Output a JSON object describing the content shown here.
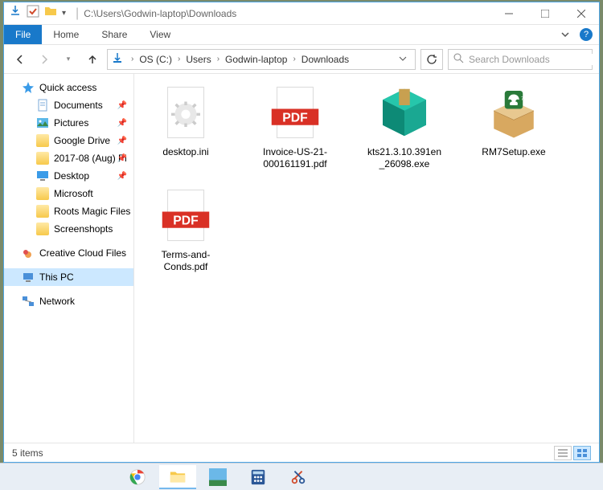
{
  "title_path": "C:\\Users\\Godwin-laptop\\Downloads",
  "ribbon": {
    "file": "File",
    "home": "Home",
    "share": "Share",
    "view": "View"
  },
  "breadcrumb": [
    "OS (C:)",
    "Users",
    "Godwin-laptop",
    "Downloads"
  ],
  "search_placeholder": "Search Downloads",
  "sidebar": {
    "quick_access": "Quick access",
    "pinned": [
      {
        "label": "Documents",
        "pinned": true
      },
      {
        "label": "Pictures",
        "pinned": true
      },
      {
        "label": "Google Drive",
        "pinned": true
      },
      {
        "label": "2017-08 (Aug) Pi",
        "pinned": true
      },
      {
        "label": "Desktop",
        "pinned": true
      },
      {
        "label": "Microsoft",
        "pinned": false
      },
      {
        "label": "Roots Magic Files",
        "pinned": false
      },
      {
        "label": "Screenshopts",
        "pinned": false
      }
    ],
    "creative_cloud": "Creative Cloud Files",
    "this_pc": "This PC",
    "network": "Network"
  },
  "files": [
    {
      "name": "desktop.ini",
      "type": "ini"
    },
    {
      "name": "Invoice-US-21-000161191.pdf",
      "type": "pdf"
    },
    {
      "name": "kts21.3.10.391en_26098.exe",
      "type": "box"
    },
    {
      "name": "RM7Setup.exe",
      "type": "installer"
    },
    {
      "name": "Terms-and-Conds.pdf",
      "type": "pdf"
    }
  ],
  "status": "5 items"
}
